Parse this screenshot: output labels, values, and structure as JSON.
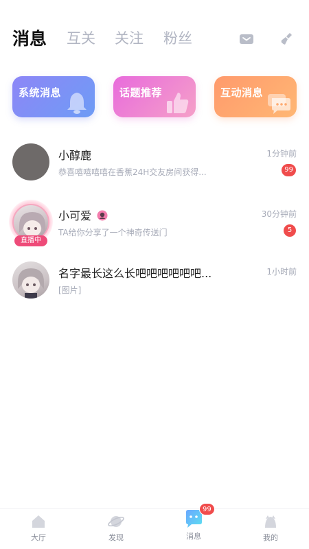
{
  "tabs": [
    {
      "label": "消息",
      "active": true
    },
    {
      "label": "互关",
      "active": false
    },
    {
      "label": "关注",
      "active": false
    },
    {
      "label": "粉丝",
      "active": false
    }
  ],
  "header_icons": [
    "mail-icon",
    "broom-icon"
  ],
  "cards": [
    {
      "label": "系统消息",
      "icon": "bell-icon"
    },
    {
      "label": "话题推荐",
      "icon": "thumbs-up-icon"
    },
    {
      "label": "互动消息",
      "icon": "chat-bubble-icon"
    }
  ],
  "conversations": [
    {
      "name": "小醇鹿",
      "preview": "恭喜嘻嘻嘻嘻在香蕉24H交友房间获得...",
      "time": "1分钟前",
      "unread": "99",
      "live": false
    },
    {
      "name": "小可爱",
      "preview": "TA给你分享了一个神奇传送门",
      "time": "30分钟前",
      "unread": "5",
      "live": true,
      "live_label": "直播中"
    },
    {
      "name": "名字最长这么长吧吧吧吧吧吧...",
      "preview": "[图片]",
      "time": "1小时前",
      "unread": "",
      "live": false
    }
  ],
  "nav": [
    {
      "label": "大厅",
      "icon": "lobby-icon"
    },
    {
      "label": "发现",
      "icon": "planet-icon"
    },
    {
      "label": "消息",
      "icon": "message-icon",
      "badge": "99",
      "active": true
    },
    {
      "label": "我的",
      "icon": "profile-icon"
    }
  ],
  "colors": {
    "accent_badge": "#f04c4c",
    "live_tag": "#ee4b79",
    "muted_text": "#a7abb8"
  }
}
